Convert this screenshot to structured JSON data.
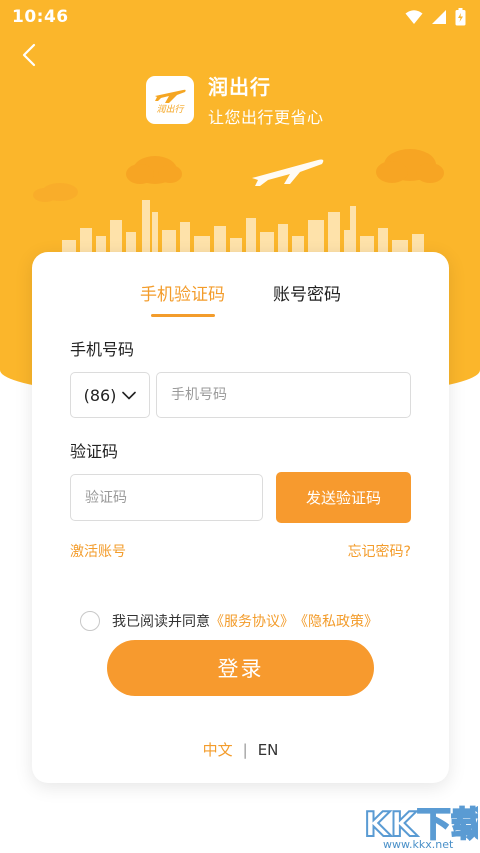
{
  "status_bar": {
    "time": "10:46",
    "icons": [
      "wifi-icon",
      "signal-icon",
      "battery-charging-icon"
    ]
  },
  "header": {
    "back_icon": "chevron-left-icon",
    "logo_text": "润出行",
    "app_name": "润出行",
    "slogan": "让您出行更省心"
  },
  "tabs": [
    {
      "label": "手机验证码",
      "active": true
    },
    {
      "label": "账号密码",
      "active": false
    }
  ],
  "form": {
    "phone_label": "手机号码",
    "country_code": "(86)",
    "phone_placeholder": "手机号码",
    "code_label": "验证码",
    "code_placeholder": "验证码",
    "send_code_label": "发送验证码",
    "activate_link": "激活账号",
    "forgot_link": "忘记密码?"
  },
  "agreement": {
    "prefix": "我已阅读并同意",
    "service_link": "《服务协议》",
    "privacy_link": "《隐私政策》"
  },
  "login_button": "登录",
  "language": {
    "zh": "中文",
    "separator": "|",
    "en": "EN"
  },
  "watermark": {
    "url": "www.kkx.net"
  },
  "colors": {
    "brand_yellow": "#fbb62b",
    "accent_orange": "#f79a2e",
    "link_orange": "#f39c2b"
  }
}
